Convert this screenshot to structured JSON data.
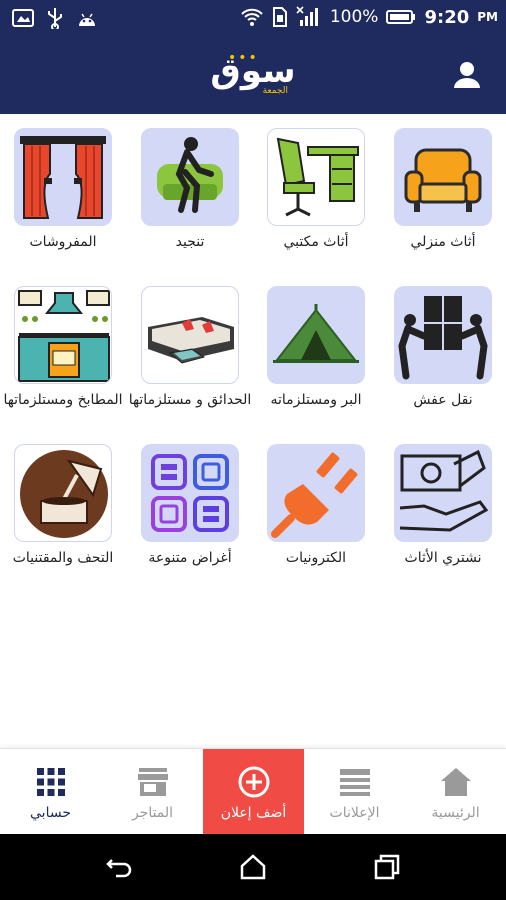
{
  "status_bar": {
    "battery_percent": "100%",
    "time": "9:20",
    "time_suffix": "PM"
  },
  "header": {
    "logo_text": "سوق",
    "logo_subtext": "الجمعة"
  },
  "categories": [
    {
      "label": "أثاث منزلي",
      "icon": "armchair-icon"
    },
    {
      "label": "أثاث مكتبي",
      "icon": "office-desk-icon"
    },
    {
      "label": "تنجيد",
      "icon": "upholstery-icon"
    },
    {
      "label": "المفروشات",
      "icon": "curtains-icon"
    },
    {
      "label": "نقل عفش",
      "icon": "moving-boxes-icon"
    },
    {
      "label": "البر ومستلزماته",
      "icon": "tent-icon"
    },
    {
      "label": "الحدائق و مستلزماتها",
      "icon": "garden-sofa-icon"
    },
    {
      "label": "المطابخ ومستلزماتها",
      "icon": "kitchen-icon"
    },
    {
      "label": "نشتري الأثاث",
      "icon": "cash-hand-icon"
    },
    {
      "label": "الكترونيات",
      "icon": "plug-icon"
    },
    {
      "label": "أغراض متنوعة",
      "icon": "grid-squares-icon"
    },
    {
      "label": "التحف والمقتنيات",
      "icon": "gramophone-icon"
    }
  ],
  "bottom_nav": {
    "home": "الرئيسية",
    "ads": "الإعلانات",
    "add_ad": "أضف إعلان",
    "stores": "المتاجر",
    "account": "حسابي"
  },
  "colors": {
    "primary": "#1f2a5e",
    "accent_yellow": "#f7c400",
    "add_button": "#f04b45",
    "tile_bg": "#d3d8f7"
  }
}
